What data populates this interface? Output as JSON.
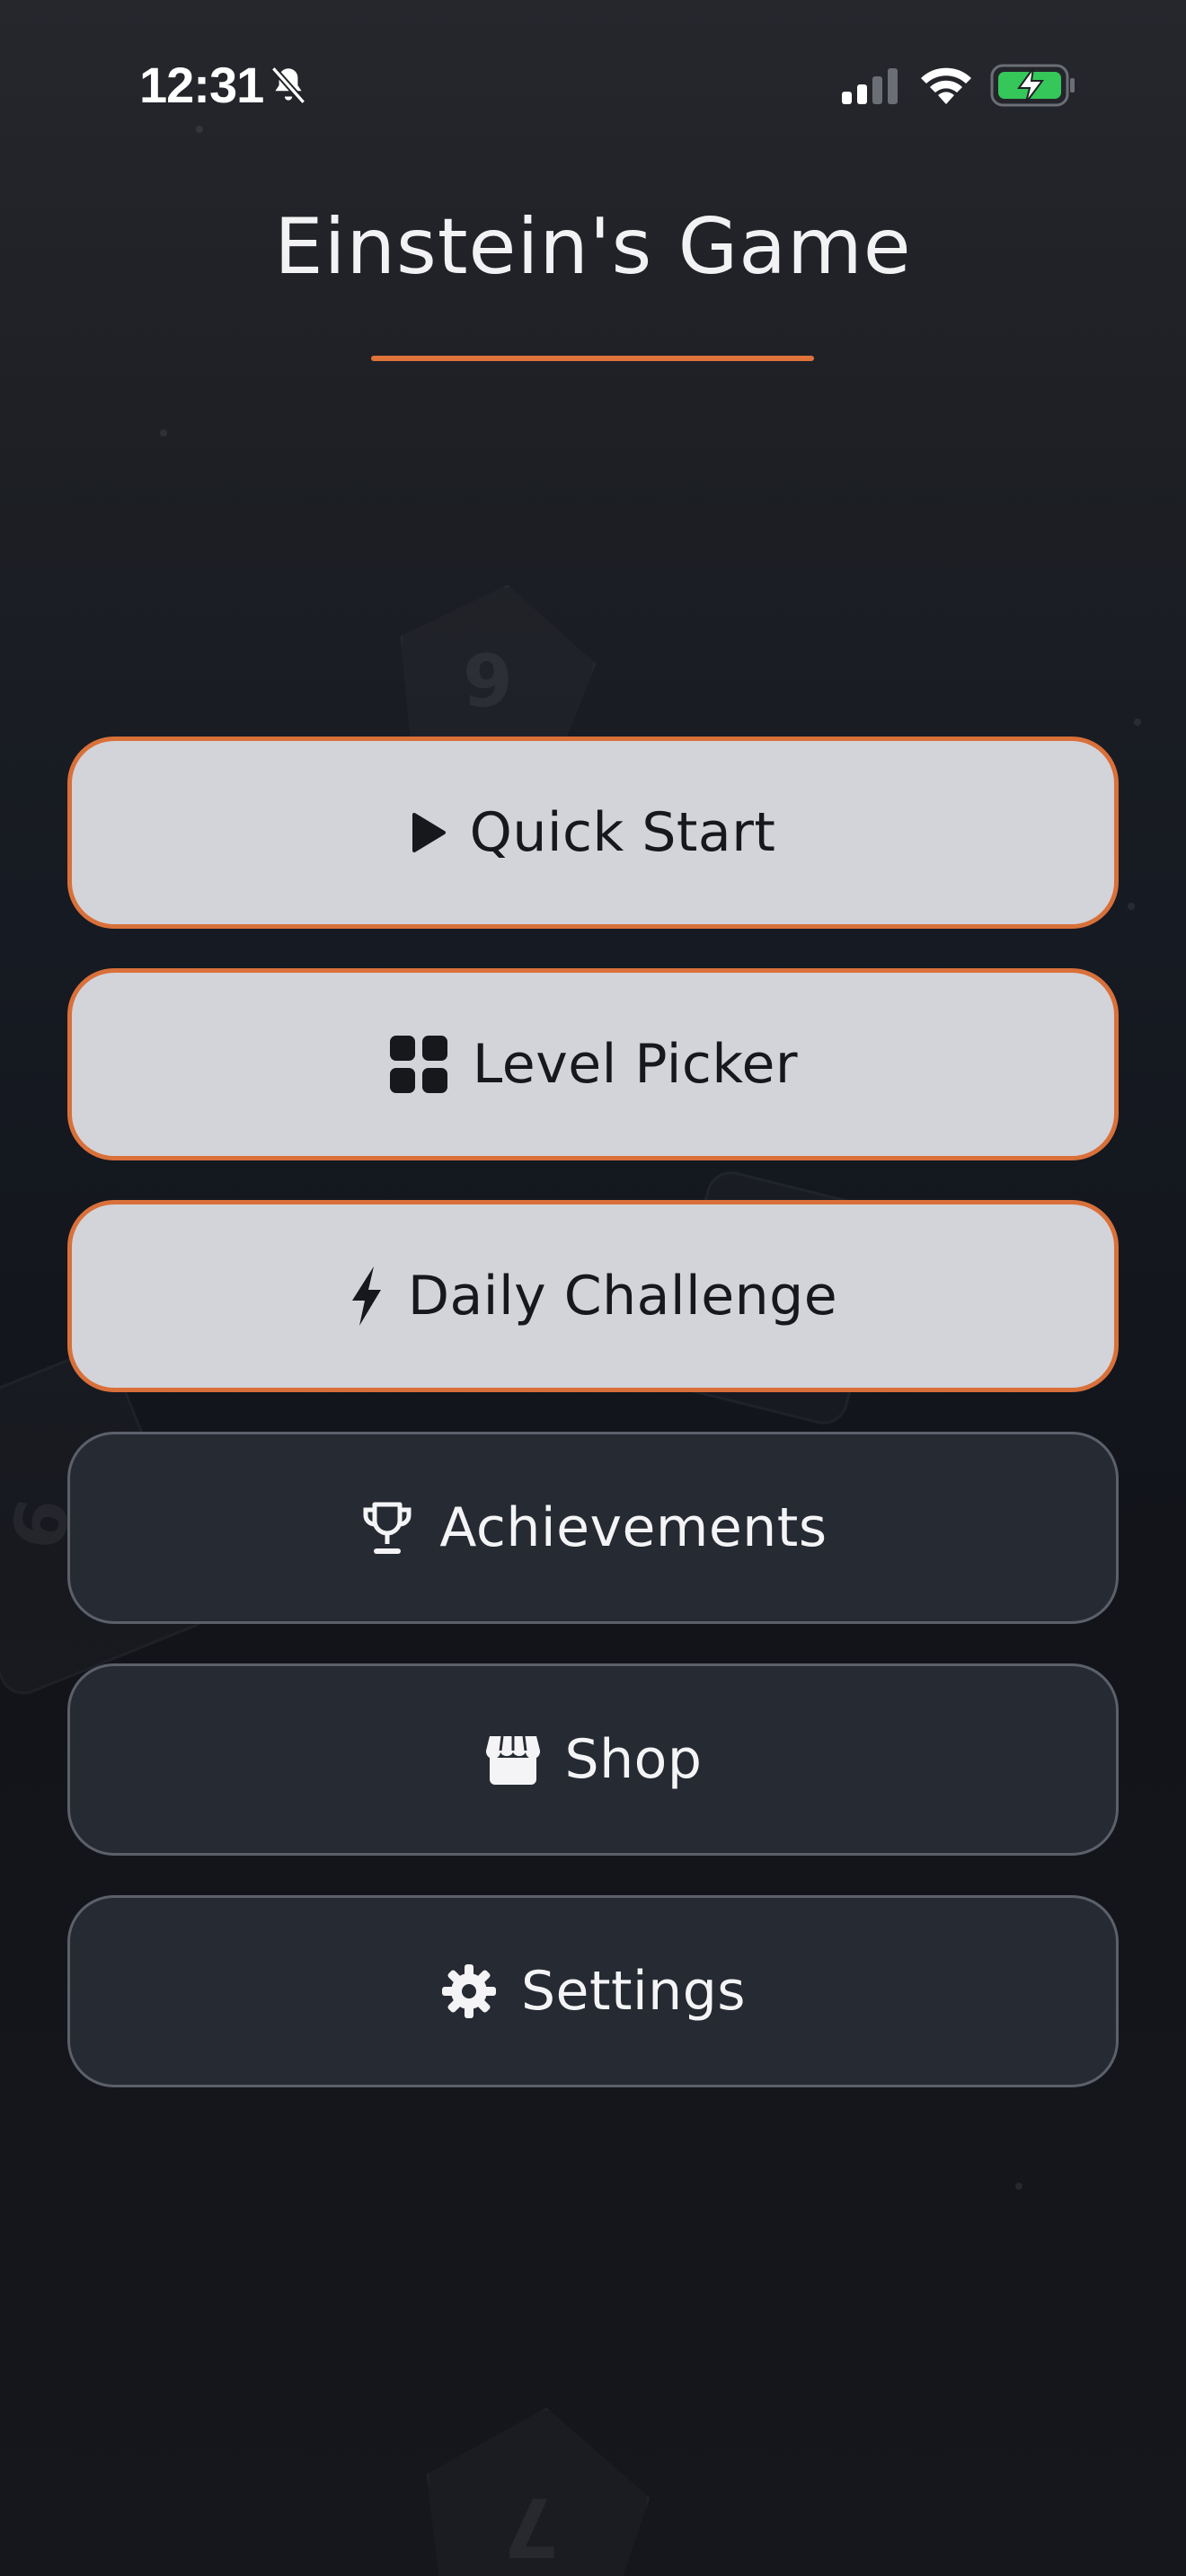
{
  "status_bar": {
    "time": "12:31",
    "silent_icon": "bell-slash-icon",
    "signal_icon": "cellular-signal-icon",
    "wifi_icon": "wifi-icon",
    "battery_icon": "battery-charging-icon",
    "battery_color": "#35c759"
  },
  "header": {
    "title": "Einstein's Game",
    "accent_color": "#e0733a"
  },
  "background": {
    "tile_digits": [
      "9",
      "6",
      "7"
    ]
  },
  "menu": {
    "items": [
      {
        "label": "Quick Start",
        "icon": "play-icon",
        "style": "primary"
      },
      {
        "label": "Level Picker",
        "icon": "grid-icon",
        "style": "primary"
      },
      {
        "label": "Daily Challenge",
        "icon": "lightning-icon",
        "style": "primary"
      },
      {
        "label": "Achievements",
        "icon": "trophy-icon",
        "style": "secondary"
      },
      {
        "label": "Shop",
        "icon": "store-icon",
        "style": "secondary"
      },
      {
        "label": "Settings",
        "icon": "gear-icon",
        "style": "secondary"
      }
    ]
  }
}
